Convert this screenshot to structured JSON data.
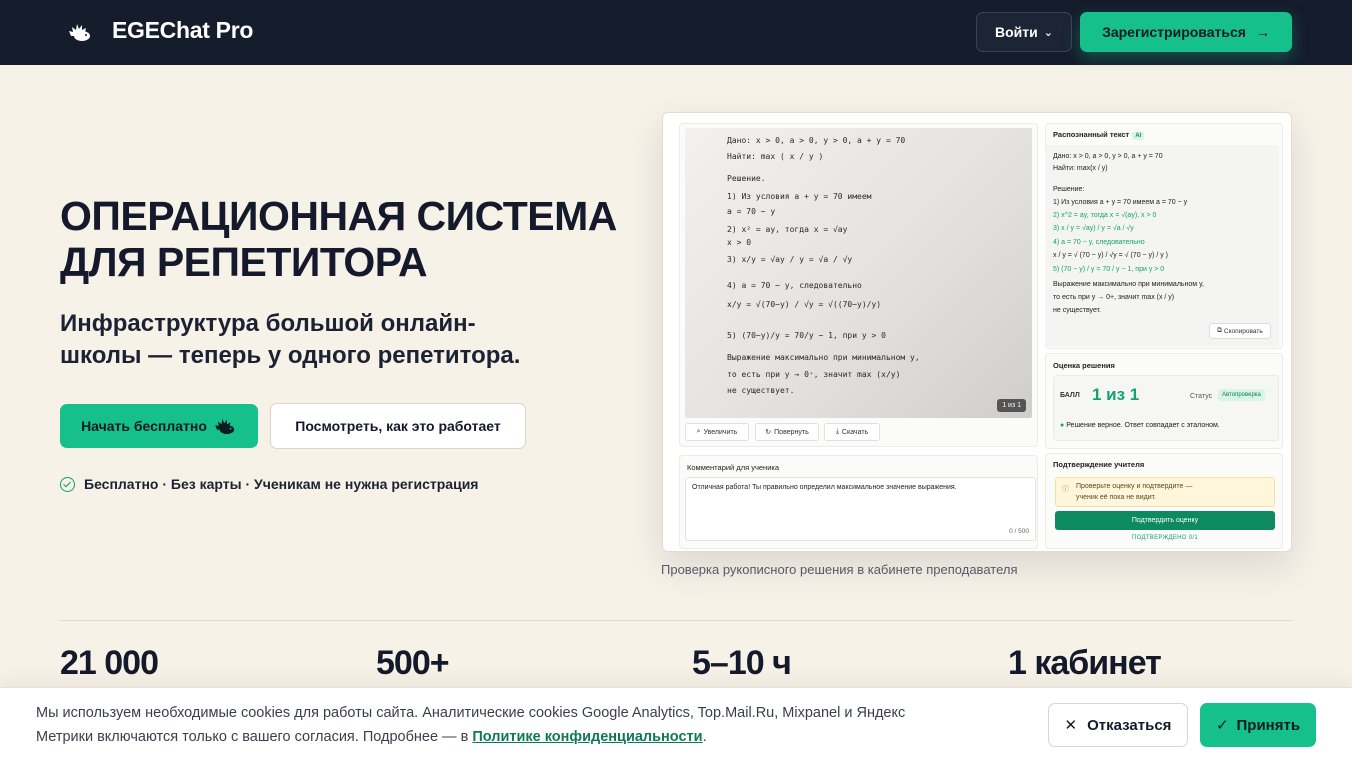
{
  "header": {
    "brand": "EGEChat Pro",
    "login_label": "Войти",
    "register_label": "Зарегистрироваться"
  },
  "hero": {
    "title_line1": "ОПЕРАЦИОННАЯ СИСТЕМА",
    "title_line2": "ДЛЯ РЕПЕТИТОРА",
    "subtitle": "Инфраструктура большой онлайн-школы — теперь у одного репетитора.",
    "start_label": "Начать бесплатно",
    "how_label": "Посмотреть, как это работает",
    "note": "Бесплатно · Без карты · Ученикам не нужна регистрация"
  },
  "screenshot": {
    "caption": "Проверка рукописного решения в кабинете преподавателя",
    "handwriting": [
      "Дано:  x > 0,  a > 0,  y > 0,  a + y = 70",
      "Найти:  max ( x / y )",
      "Решение.",
      "1)  Из условия  a + y = 70  имеем",
      "     a = 70 − y",
      "2)  x² = ay,  тогда  x = √ay",
      "     x > 0",
      "3)  x/y = √ay / y = √a / √y",
      "4)  a = 70 − y,  следовательно",
      "     x/y = √(70−y) / √y = √((70−y)/y)",
      "5)  (70−y)/y = 70/y − 1,  при  y > 0",
      "     Выражение максимально при минимальном  y,",
      "     то есть при  y → 0⁺,  значит  max (x/y)",
      "     не существует."
    ],
    "page_badge": "1 из 1",
    "tools": [
      "Увеличить",
      "Повернуть",
      "Скачать"
    ],
    "recognized_title": "Распознанный текст",
    "ai_tag": "AI",
    "recognized_lines": [
      "Дано: x > 0, a > 0, y > 0, a + y = 70",
      "Найти: max(x / y)",
      "Решение:",
      "1) Из условия a + y = 70 имеем a = 70 − y",
      "2) x^2 = ay, тогда x = √(ay), x > 0",
      "3) x / y = √ay) / y = √a / √y",
      "4) a = 70 − y, следовательно",
      "x / y = √ (70 − y) / √y = √ (70 − y) / y )",
      "5) (70 − y) / y = 70 / y − 1, при y > 0",
      "Выражение максимально при минимальном y,",
      "то есть при y → 0+, значит max (x / y)",
      "не существует."
    ],
    "copy_label": "Скопировать",
    "score_title": "Оценка решения",
    "score_label": "БАЛЛ",
    "score_value": "1 из 1",
    "status_label": "Статус",
    "status_value": "Автопроверка",
    "score_note": "Решение верное. Ответ совпадает с эталоном.",
    "comment_title": "Комментарий для ученика",
    "comment_text": "Отличная работа! Ты правильно определил максимальное значение выражения.",
    "comment_count": "0 / 500",
    "confirm_title": "Подтверждение учителя",
    "warn_text_1": "Проверьте оценку и подтвердите —",
    "warn_text_2": "ученик её пока не видит.",
    "confirm_button": "Подтвердить оценку",
    "confirmed_counter": "ПОДТВЕРЖДЕНО 0/1"
  },
  "stats": [
    "21 000",
    "500+",
    "5–10 ч",
    "1 кабинет"
  ],
  "cookie": {
    "text": "Мы используем необходимые cookies для работы сайта. Аналитические cookies Google Analytics, Top.Mail.Ru, Mixpanel и Яндекс Метрики включаются только с вашего согласия. Подробнее — в",
    "link": "Политике конфиденциальности",
    "tail": ".",
    "decline_label": "Отказаться",
    "accept_label": "Принять"
  },
  "colors": {
    "header_bg": "#151c2c",
    "accent": "#16c08a",
    "page_bg": "#f7f2e8"
  }
}
